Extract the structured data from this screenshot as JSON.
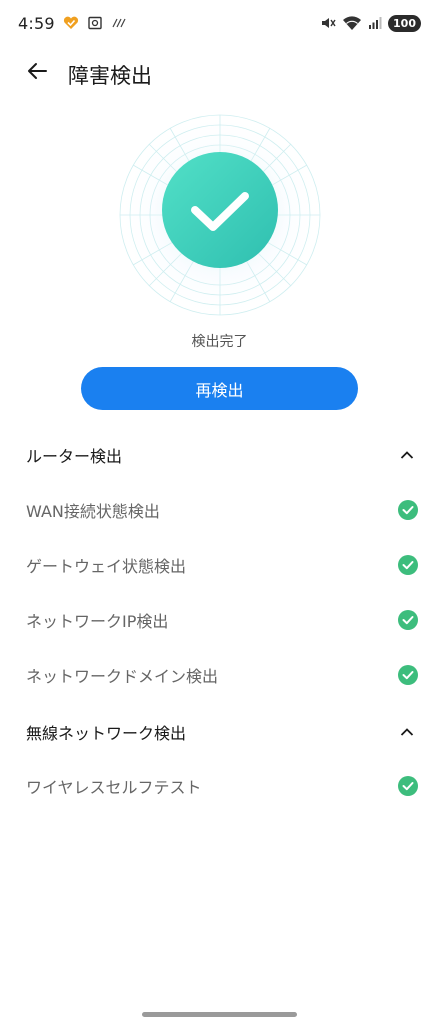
{
  "status_bar": {
    "time": "4:59",
    "battery": "100",
    "left_icons": [
      "heart-badge-icon",
      "screenshot-icon",
      "hatch-icon"
    ],
    "right_icons": [
      "mute-icon",
      "wifi-icon",
      "signal-icon"
    ]
  },
  "header": {
    "title": "障害検出"
  },
  "result": {
    "status": "検出完了",
    "accent_color": "#3cc9b4"
  },
  "actions": {
    "recheck_label": "再検出",
    "button_color": "#1a80f0"
  },
  "sections": [
    {
      "title": "ルーター検出",
      "expanded": true,
      "items": [
        {
          "label": "WAN接続状態検出",
          "status": "ok"
        },
        {
          "label": "ゲートウェイ状態検出",
          "status": "ok"
        },
        {
          "label": "ネットワークIP検出",
          "status": "ok"
        },
        {
          "label": "ネットワークドメイン検出",
          "status": "ok"
        }
      ]
    },
    {
      "title": "無線ネットワーク検出",
      "expanded": true,
      "items": [
        {
          "label": "ワイヤレスセルフテスト",
          "status": "ok"
        }
      ]
    }
  ],
  "check_color": "#3dbd7d"
}
